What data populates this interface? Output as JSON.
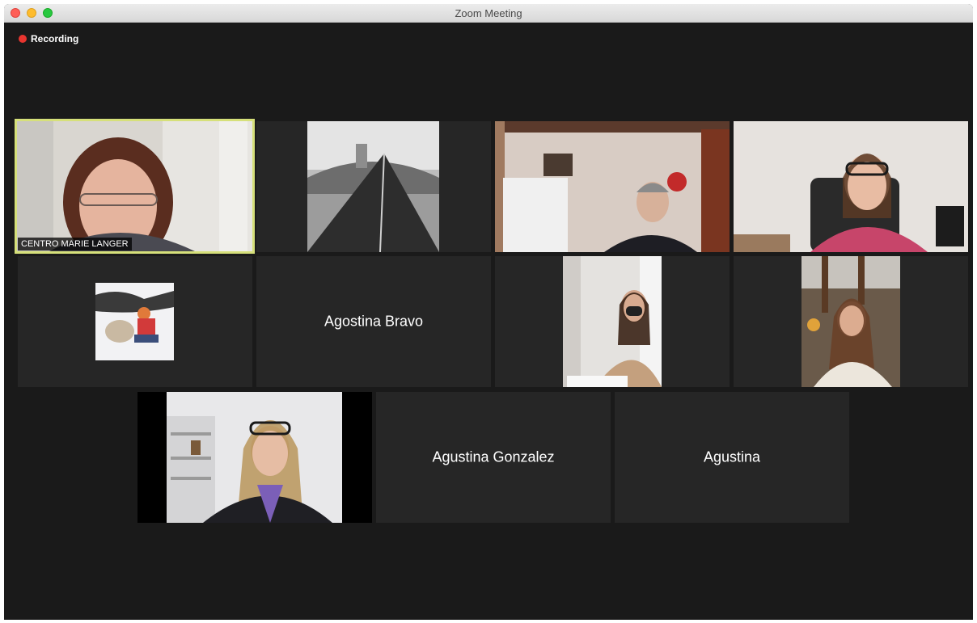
{
  "window": {
    "title": "Zoom Meeting"
  },
  "recording": {
    "label": "Recording",
    "color": "#e8352f"
  },
  "participants": [
    {
      "name": "CENTRO MARIE LANGER",
      "speaking": true
    },
    {
      "name": "",
      "avatar": "gondola-photo"
    },
    {
      "name": ""
    },
    {
      "name": ""
    },
    {
      "name": "",
      "avatar": "snow-dog-photo"
    },
    {
      "name": "Agostina Bravo"
    },
    {
      "name": ""
    },
    {
      "name": ""
    },
    {
      "name": ""
    },
    {
      "name": "Agustina Gonzalez"
    },
    {
      "name": "Agustina"
    }
  ],
  "colors": {
    "background": "#1a1a1a",
    "tile": "#262626",
    "active_border": "#d6e07a"
  }
}
